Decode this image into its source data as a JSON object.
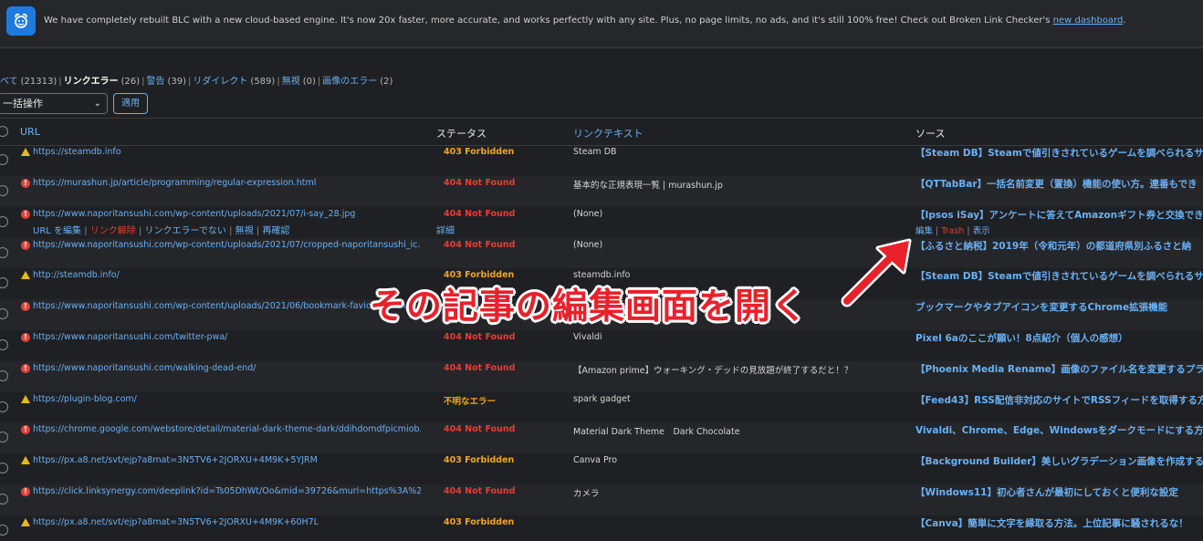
{
  "notice": {
    "text": "We have completely rebuilt BLC with a new cloud-based engine. It's now 20x faster, more accurate, and works perfectly with any site. Plus, no page limits, no ads, and it's still 100% free! Check out Broken Link Checker's ",
    "link": "new dashboard",
    "tail": "."
  },
  "filters": [
    {
      "label": "べて",
      "count": "(21313)",
      "current": false
    },
    {
      "label": "リンクエラー",
      "count": "(26)",
      "current": true
    },
    {
      "label": "警告",
      "count": "(39)",
      "current": false
    },
    {
      "label": "リダイレクト",
      "count": "(589)",
      "current": false
    },
    {
      "label": "無視",
      "count": "(0)",
      "current": false
    },
    {
      "label": "画像のエラー",
      "count": "(2)",
      "current": false
    }
  ],
  "bulk_action": {
    "selected": "一括操作",
    "apply_label": "適用"
  },
  "columns": {
    "url": "URL",
    "status": "ステータス",
    "link_text": "リンクテキスト",
    "source": "ソース"
  },
  "row_actions": {
    "edit_url": "URL を編集",
    "unlink": "リンク解除",
    "not_broken": "リンクエラーでない",
    "ignore": "無視",
    "recheck": "再確認",
    "details": "詳細",
    "src_edit": "編集",
    "src_trash": "Trash",
    "src_view": "表示"
  },
  "rows": [
    {
      "icon": "warning-icon",
      "url": "https://steamdb.info",
      "status": "403 Forbidden",
      "status_type": "403",
      "text": "Steam DB",
      "source": "【Steam DB】Steamで値引きされているゲームを調べられるサ"
    },
    {
      "icon": "error-icon",
      "url": "https://murashun.jp/article/programming/regular-expression.html",
      "status": "404 Not Found",
      "status_type": "404",
      "text": "基本的な正規表現一覧 | murashun.jp",
      "source": "【QTTabBar】一括名前変更（置換）機能の使い方。連番もでき"
    },
    {
      "icon": "error-icon",
      "url": "https://www.naporitansushi.com/wp-content/uploads/2021/07/i-say_28.jpg",
      "status": "404 Not Found",
      "status_type": "404",
      "text": "(None)",
      "source": "【Ipsos iSay】アンケートに答えてAmazonギフト券と交換でき"
    },
    {
      "icon": "error-icon",
      "url": "https://www.naporitansushi.com/wp-content/uploads/2021/07/cropped-naporitansushi_ic...",
      "status": "404 Not Found",
      "status_type": "404",
      "text": "(None)",
      "source": "【ふるさと納税】2019年（令和元年）の都道府県別ふるさと納"
    },
    {
      "icon": "warning-icon",
      "url": "http://steamdb.info/",
      "status": "403 Forbidden",
      "status_type": "403",
      "text": "steamdb.info",
      "source": "【Steam DB】Steamで値引きされているゲームを調べられるサ"
    },
    {
      "icon": "error-icon",
      "url": "https://www.naporitansushi.com/wp-content/uploads/2021/06/bookmark-favicon-change",
      "status": "",
      "status_type": "404",
      "text": "",
      "source": "ブックマークやタブアイコンを変更するChrome拡張機能"
    },
    {
      "icon": "error-icon",
      "url": "https://www.naporitansushi.com/twitter-pwa/",
      "status": "404 Not Found",
      "status_type": "404",
      "text": "Vivaldi",
      "source": "Pixel 6aのここが願い！8点紹介（個人の感想）"
    },
    {
      "icon": "error-icon",
      "url": "https://www.naporitansushi.com/walking-dead-end/",
      "status": "404 Not Found",
      "status_type": "404",
      "text": "【Amazon prime】ウォーキング・デッドの見放題が終了するだと！？",
      "source": "【Phoenix Media Rename】画像のファイル名を変更するプラグ"
    },
    {
      "icon": "warning-icon",
      "url": "https://plugin-blog.com/",
      "status": "不明なエラー",
      "status_type": "unknown",
      "text": "spark gadget",
      "source": "【Feed43】RSS配信非対応のサイトでRSSフィードを取得する方"
    },
    {
      "icon": "error-icon",
      "url": "https://chrome.google.com/webstore/detail/material-dark-theme-dark/ddihdomdfpicmiob...",
      "status": "404 Not Found",
      "status_type": "404",
      "text": "Material Dark Theme　Dark Chocolate",
      "source": "Vivaldi、Chrome、Edge、Windowsをダークモードにする方法"
    },
    {
      "icon": "warning-icon",
      "url": "https://px.a8.net/svt/ejp?a8mat=3N5TV6+2JORXU+4M9K+5YJRM",
      "status": "403 Forbidden",
      "status_type": "403",
      "text": "Canva Pro",
      "source": "【Background Builder】美しいグラデーション画像を作成する"
    },
    {
      "icon": "error-icon",
      "url": "https://click.linksynergy.com/deeplink?id=Ts05DhWt/Oo&mid=39726&murl=https%3A%2...",
      "status": "404 Not Found",
      "status_type": "404",
      "text": "カメラ",
      "source": "【Windows11】初心者さんが最初にしておくと便利な設定"
    },
    {
      "icon": "warning-icon",
      "url": "https://px.a8.net/svt/ejp?a8mat=3N5TV6+2JORXU+4M9K+60H7L",
      "status": "403 Forbidden",
      "status_type": "403",
      "text": "",
      "source": "【Canva】簡単に文字を縁取る方法。上位記事に騒されるな！"
    }
  ],
  "annotation": {
    "text": "その記事の編集画面を開く",
    "color": "#e8212b"
  }
}
